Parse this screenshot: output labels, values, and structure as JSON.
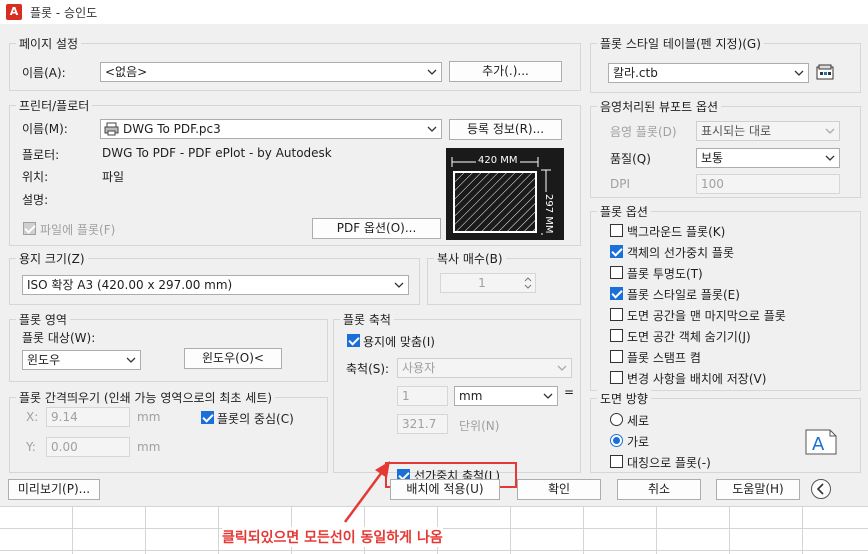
{
  "window": {
    "title": "플롯 - 승인도",
    "icon_letter": "A"
  },
  "page_setup": {
    "legend": "페이지 설정",
    "name_label": "이름(A):",
    "name_value": "<없음>",
    "add_button": "추가(.)..."
  },
  "printer": {
    "legend": "프린터/플로터",
    "name_label": "이름(M):",
    "name_value": "DWG To PDF.pc3",
    "properties_button": "등록 정보(R)...",
    "plotter_label": "플로터:",
    "plotter_value": "DWG To PDF - PDF ePlot - by Autodesk",
    "location_label": "위치:",
    "location_value": "파일",
    "description_label": "설명:",
    "plot_to_file": "파일에 플롯(F)",
    "pdf_options_button": "PDF 옵션(O)...",
    "preview_width": "420 MM",
    "preview_height": "297 MM"
  },
  "paper_size": {
    "legend": "용지 크기(Z)",
    "value": "ISO 확장 A3 (420.00 x 297.00 mm)"
  },
  "copies": {
    "legend": "복사 매수(B)",
    "value": "1"
  },
  "plot_area": {
    "legend": "플롯 영역",
    "what_label": "플롯 대상(W):",
    "what_value": "윈도우",
    "window_button": "윈도우(O)<"
  },
  "plot_offset": {
    "legend": "플롯 간격띄우기 (인쇄 가능 영역으로의 최초 세트)",
    "x_label": "X:",
    "x_value": "9.14",
    "x_unit": "mm",
    "y_label": "Y:",
    "y_value": "0.00",
    "y_unit": "mm",
    "center": "플롯의 중심(C)"
  },
  "plot_scale": {
    "legend": "플롯 축척",
    "fit_paper": "용지에 맞춤(I)",
    "scale_label": "축척(S):",
    "scale_value": "사용자",
    "value1": "1",
    "unit_value": "mm",
    "equals": "=",
    "value2": "321.7",
    "units_label": "단위(N)",
    "scale_lineweights": "선가중치 축척(L)"
  },
  "plot_style_table": {
    "legend": "플롯 스타일 테이블(펜 지정)(G)",
    "value": "칼라.ctb"
  },
  "shaded_viewport": {
    "legend": "음영처리된 뷰포트 옵션",
    "shade_label": "음영 플롯(D)",
    "shade_value": "표시되는 대로",
    "quality_label": "품질(Q)",
    "quality_value": "보통",
    "dpi_label": "DPI",
    "dpi_value": "100"
  },
  "plot_options": {
    "legend": "플롯 옵션",
    "items": [
      {
        "label": "백그라운드 플롯(K)",
        "checked": false
      },
      {
        "label": "객체의 선가중치 플롯",
        "checked": true
      },
      {
        "label": "플롯 투명도(T)",
        "checked": false
      },
      {
        "label": "플롯 스타일로 플롯(E)",
        "checked": true
      },
      {
        "label": "도면 공간을 맨 마지막으로 플롯",
        "checked": false
      },
      {
        "label": "도면 공간 객체 숨기기(J)",
        "checked": false
      },
      {
        "label": "플롯 스탬프 켬",
        "checked": false
      },
      {
        "label": "변경 사항을 배치에 저장(V)",
        "checked": false
      }
    ]
  },
  "orientation": {
    "legend": "도면 방향",
    "portrait": "세로",
    "landscape": "가로",
    "upside_down": "대칭으로 플롯(-)"
  },
  "footer": {
    "preview_button": "미리보기(P)...",
    "apply_button": "배치에 적용(U)",
    "ok_button": "확인",
    "cancel_button": "취소",
    "help_button": "도움말(H)"
  },
  "annotation": {
    "text": "클릭되있으면 모든선이 동일하게 나옴",
    "color": "#e53935"
  }
}
